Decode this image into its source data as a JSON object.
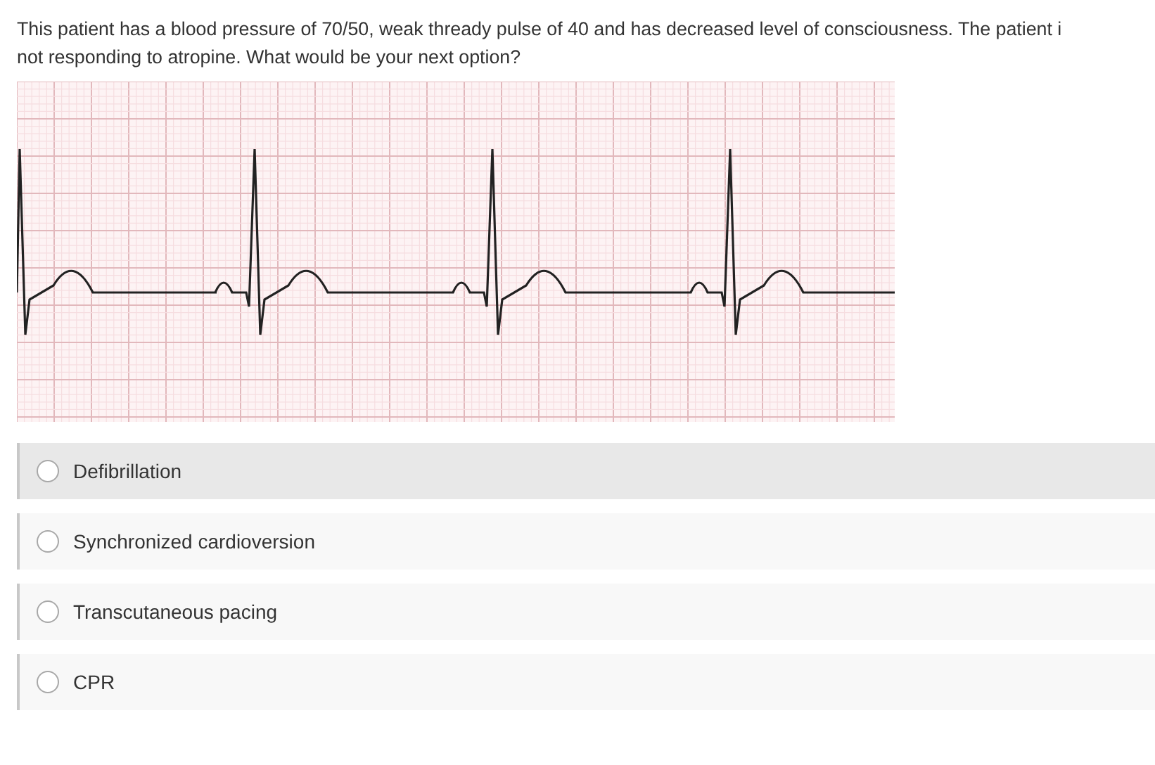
{
  "question": {
    "lines": [
      "This patient has a blood pressure of 70/50, weak thready pulse of 40 and has decreased level of consciousness. The patient i",
      "not responding to atropine. What would be your next option?"
    ]
  },
  "options": [
    {
      "label": "Defibrillation",
      "selected": false,
      "highlighted": true
    },
    {
      "label": "Synchronized cardioversion",
      "selected": false,
      "highlighted": false
    },
    {
      "label": "Transcutaneous pacing",
      "selected": false,
      "highlighted": false
    },
    {
      "label": "CPR",
      "selected": false,
      "highlighted": false
    }
  ]
}
